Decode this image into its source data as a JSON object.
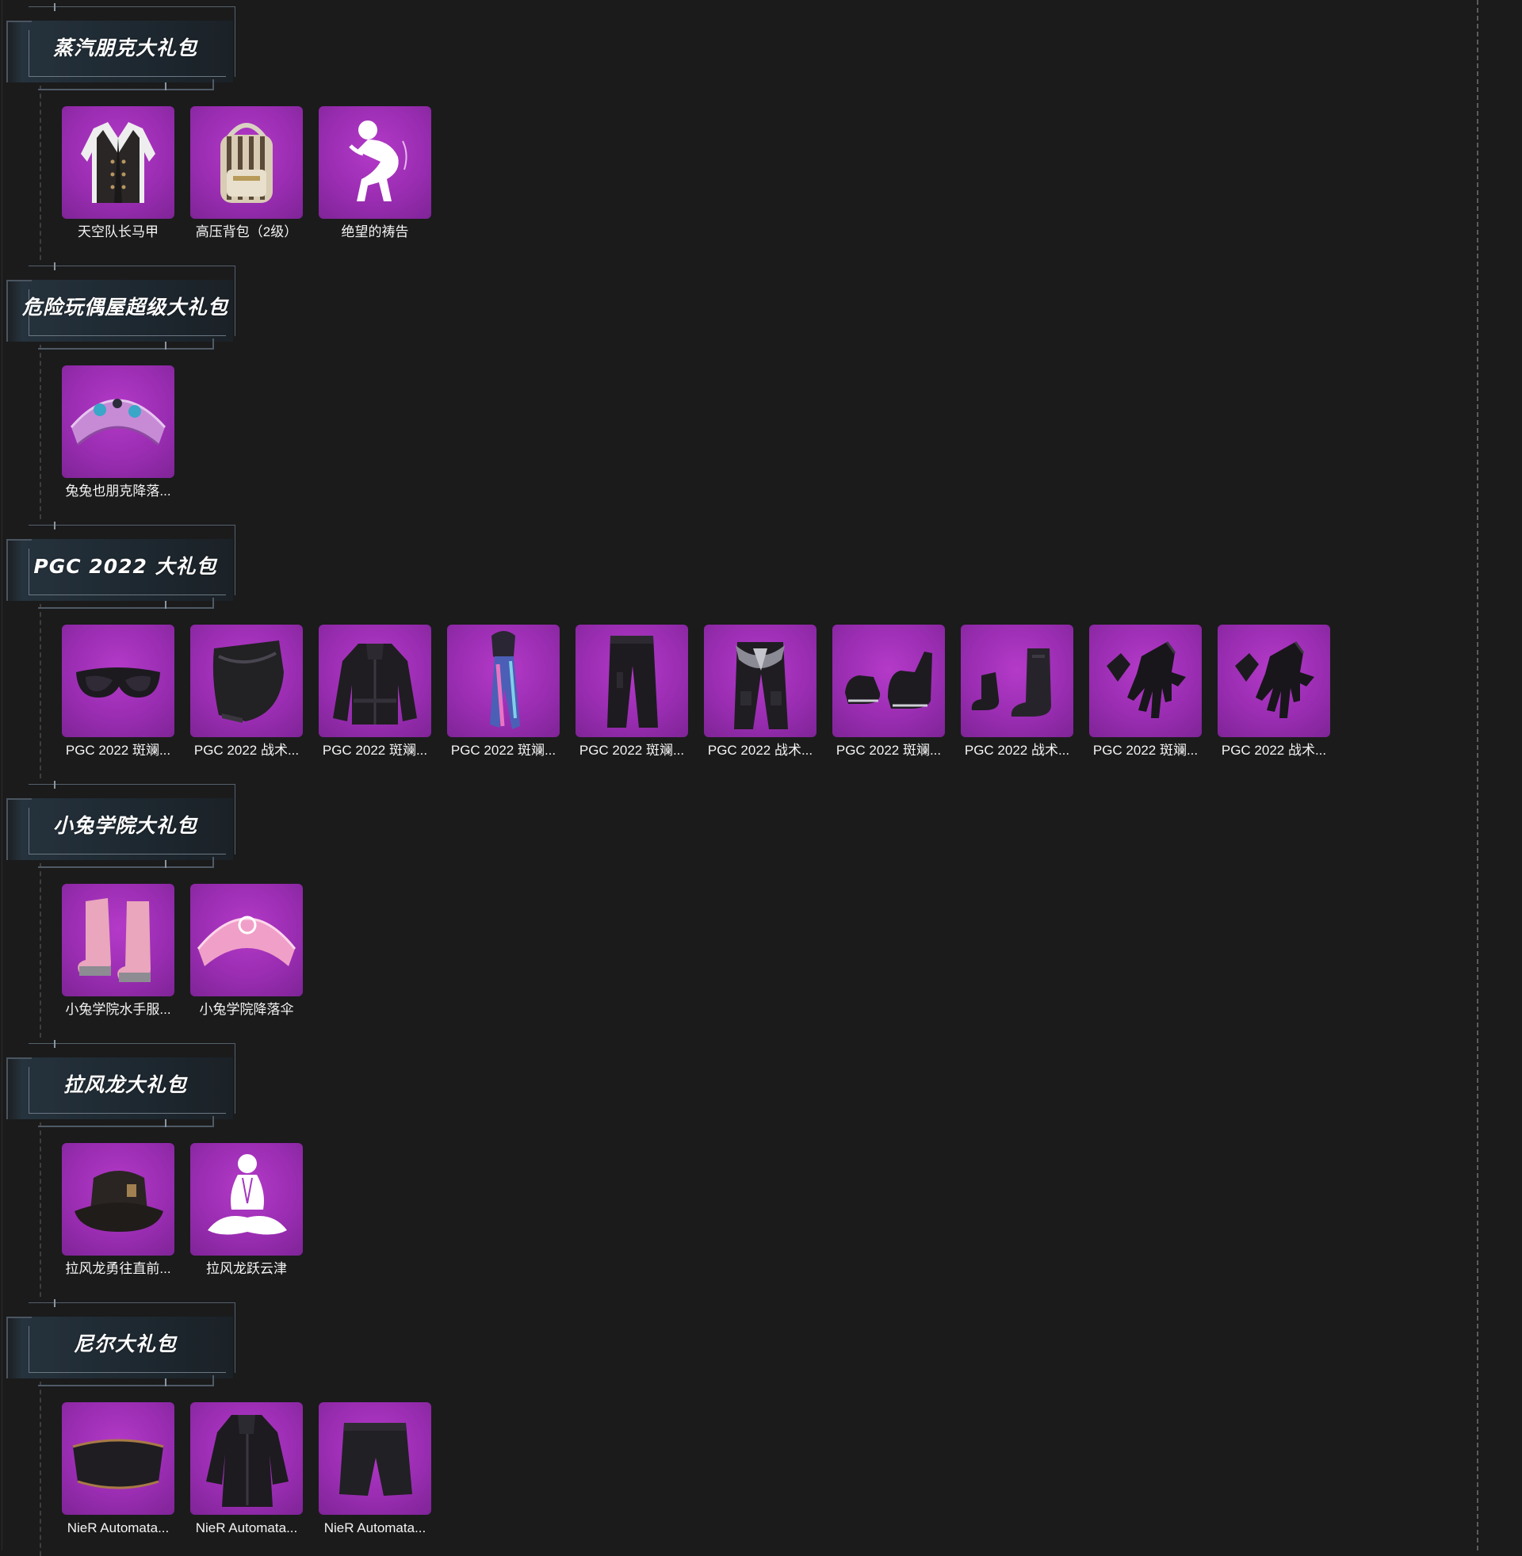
{
  "sections": [
    {
      "title": "蒸汽朋克大礼包",
      "items": [
        {
          "label": "天空队长马甲",
          "icon": "vest-icon"
        },
        {
          "label": "高压背包（2级）",
          "icon": "backpack-icon"
        },
        {
          "label": "绝望的祷告",
          "icon": "emote-prayer-icon"
        }
      ]
    },
    {
      "title": "危险玩偶屋超级大礼包",
      "items": [
        {
          "label": "兔兔也朋克降落...",
          "icon": "parachute-icon"
        }
      ]
    },
    {
      "title": "PGC 2022 大礼包",
      "items": [
        {
          "label": "PGC 2022 斑斓...",
          "icon": "goggles-icon"
        },
        {
          "label": "PGC 2022 战术...",
          "icon": "mask-icon"
        },
        {
          "label": "PGC 2022 斑斓...",
          "icon": "jacket-icon"
        },
        {
          "label": "PGC 2022 斑斓...",
          "icon": "hood-scarf-icon"
        },
        {
          "label": "PGC 2022 斑斓...",
          "icon": "pants-icon"
        },
        {
          "label": "PGC 2022 战术...",
          "icon": "tactical-pants-icon"
        },
        {
          "label": "PGC 2022 斑斓...",
          "icon": "shoes-icon"
        },
        {
          "label": "PGC 2022 战术...",
          "icon": "boots-icon"
        },
        {
          "label": "PGC 2022 斑斓...",
          "icon": "gloves-icon"
        },
        {
          "label": "PGC 2022 战术...",
          "icon": "gloves-icon"
        }
      ]
    },
    {
      "title": "小兔学院大礼包",
      "items": [
        {
          "label": "小兔学院水手服...",
          "icon": "pink-boots-icon"
        },
        {
          "label": "小兔学院降落伞",
          "icon": "pink-parachute-icon"
        }
      ]
    },
    {
      "title": "拉风龙大礼包",
      "items": [
        {
          "label": "拉风龙勇往直前...",
          "icon": "bucket-hat-icon"
        },
        {
          "label": "拉风龙跃云津",
          "icon": "emote-meditate-icon"
        }
      ]
    },
    {
      "title": "尼尔大礼包",
      "items": [
        {
          "label": "NieR Automata...",
          "icon": "blindfold-icon"
        },
        {
          "label": "NieR Automata...",
          "icon": "coat-icon"
        },
        {
          "label": "NieR Automata...",
          "icon": "shorts-icon"
        }
      ]
    }
  ],
  "colors": {
    "background": "#1b1b1c",
    "tile": "#9a2db2",
    "header_panel": "#293844",
    "text": "#f4f4f4"
  }
}
